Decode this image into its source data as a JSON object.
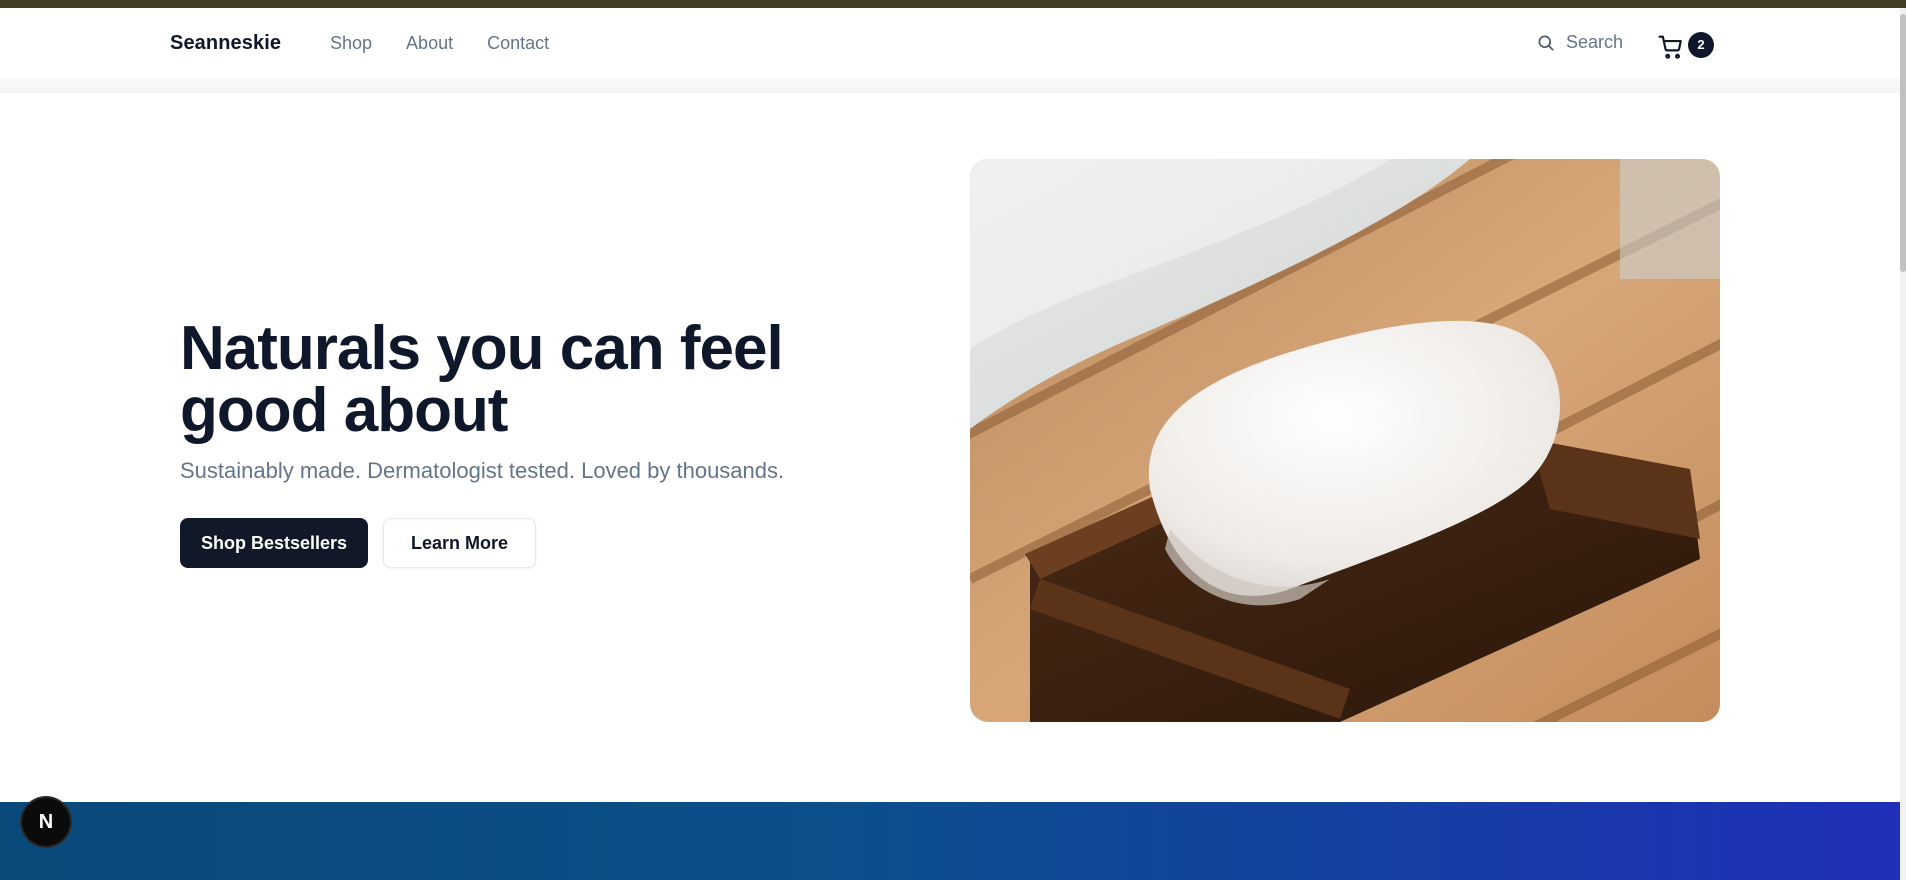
{
  "header": {
    "brand": "Seanneskie",
    "nav": [
      "Shop",
      "About",
      "Contact"
    ],
    "search_label": "Search",
    "cart_count": "2"
  },
  "hero": {
    "title": "Naturals you can feel good about",
    "subtitle": "Sustainably made. Dermatologist tested. Loved by thousands.",
    "primary_button": "Shop Bestsellers",
    "secondary_button": "Learn More"
  },
  "badge": {
    "letter": "N"
  },
  "colors": {
    "primary": "#111827",
    "muted_text": "#64748b",
    "band_start": "#0a4a7a",
    "band_end": "#1f2fb8"
  },
  "icons": {
    "search": "search-icon",
    "cart": "cart-icon"
  }
}
